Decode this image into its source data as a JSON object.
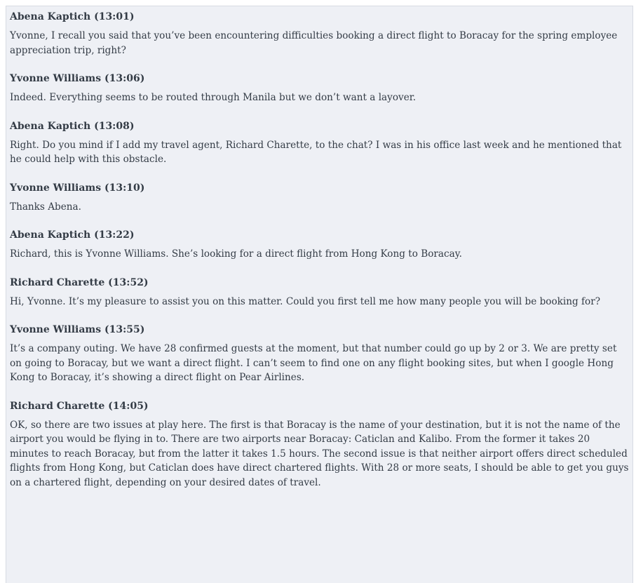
{
  "messages": [
    {
      "author": "Abena Kaptich",
      "time": "(13:01)",
      "text": "Yvonne, I recall you said that you’ve been encountering difficulties booking a direct flight to Boracay for the spring employee appreciation trip, right?"
    },
    {
      "author": "Yvonne Williams",
      "time": "(13:06)",
      "text": "Indeed. Everything seems to be routed through Manila but we don’t want a layover."
    },
    {
      "author": "Abena Kaptich",
      "time": "(13:08)",
      "text": "Right. Do you mind if I add my travel agent, Richard Charette, to the chat? I was in his office last week and he mentioned that he could help with this obstacle."
    },
    {
      "author": "Yvonne Williams",
      "time": "(13:10)",
      "text": "Thanks Abena."
    },
    {
      "author": "Abena Kaptich",
      "time": "(13:22)",
      "text": "Richard, this is Yvonne Williams. She’s looking for a direct flight from Hong Kong to Boracay."
    },
    {
      "author": "Richard Charette",
      "time": "(13:52)",
      "text": "Hi, Yvonne. It’s my pleasure to assist you on this matter. Could you first tell me how many people you will be booking for?"
    },
    {
      "author": "Yvonne Williams",
      "time": "(13:55)",
      "text": "It’s a company outing. We have 28 confirmed guests at the moment, but that number could go up by 2 or 3. We are pretty set on going to Boracay, but we want a direct flight. I can’t seem to find one on any flight booking sites, but when I google Hong Kong to Boracay, it’s showing a direct flight on Pear Airlines."
    },
    {
      "author": "Richard Charette",
      "time": "(14:05)",
      "text": "OK, so there are two issues at play here. The first is that Boracay is the name of your destination, but it is not the name of the airport you would be flying in to. There are two airports near Boracay: Caticlan and Kalibo. From the former it takes 20 minutes to reach Boracay, but from the latter it takes 1.5 hours. The second issue is that neither airport offers direct scheduled flights from Hong Kong, but Caticlan does have direct chartered flights. With 28 or more seats, I should be able to get you guys on a chartered flight, depending on your desired dates of travel."
    }
  ]
}
